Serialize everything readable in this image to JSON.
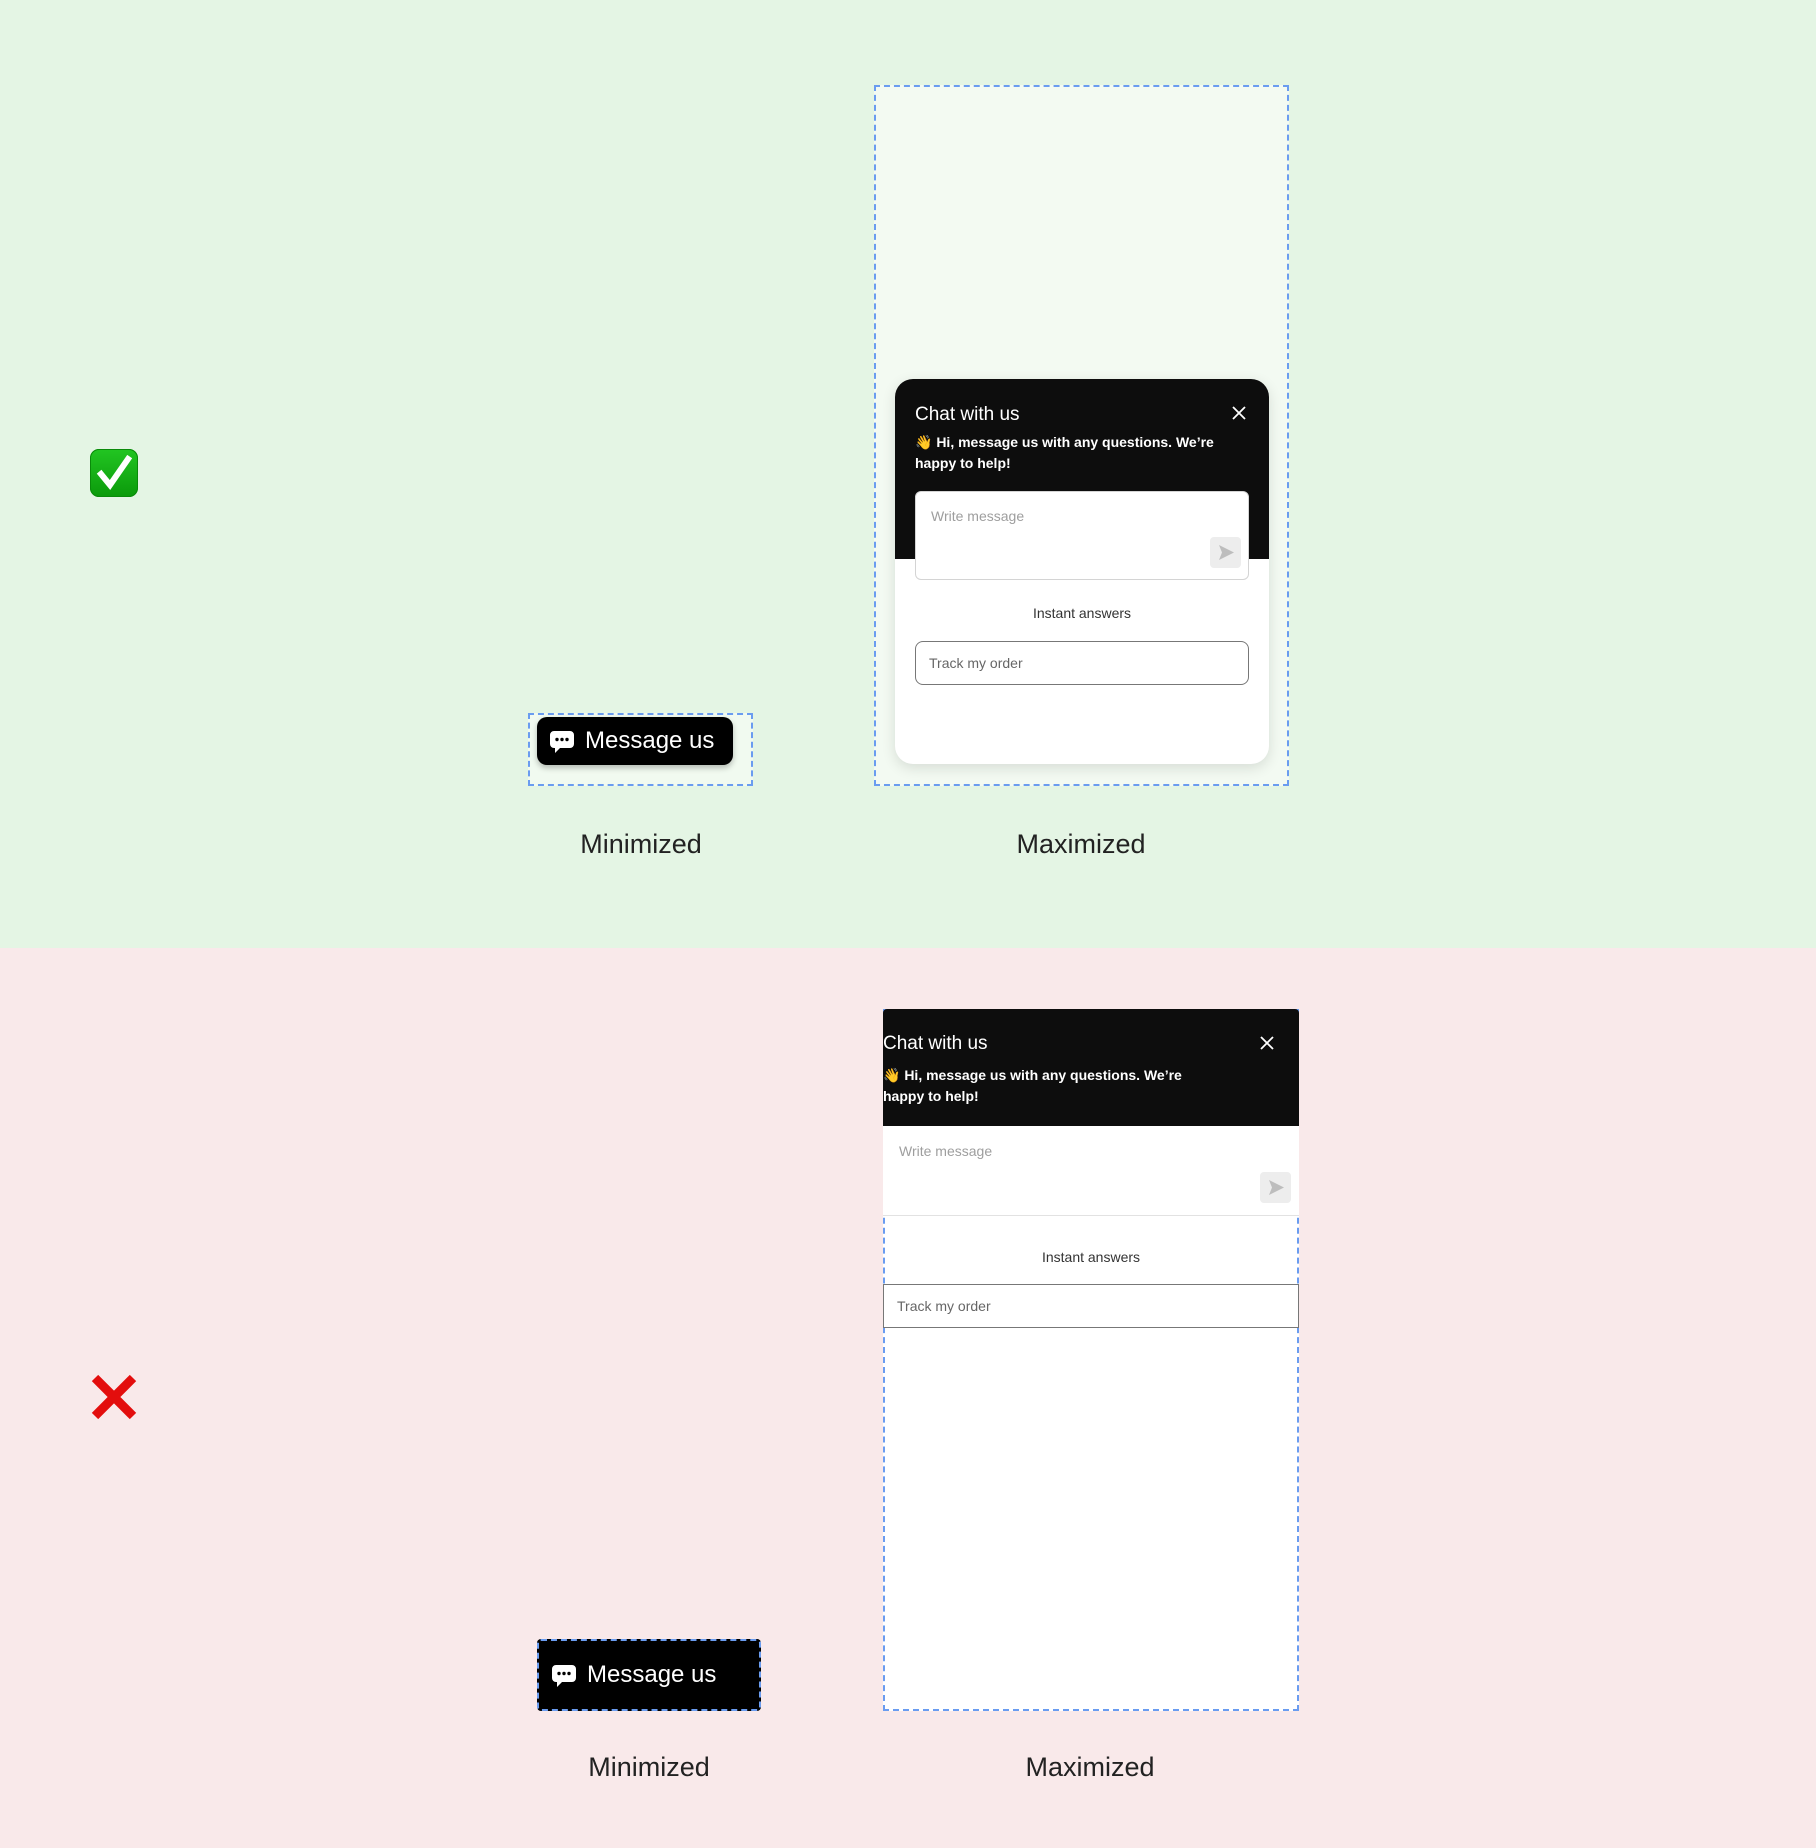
{
  "good_example": {
    "verdict_icon": "check-mark-button-icon",
    "accent_color": "#e4f5e4",
    "minimized": {
      "button_label": "Message us",
      "button_icon": "speech-bubble-icon",
      "caption": "Minimized"
    },
    "maximized": {
      "caption": "Maximized",
      "chat": {
        "title": "Chat with us",
        "close_icon": "close-icon",
        "greeting": "👋 Hi, message us with any questions. We’re happy to help!",
        "message_placeholder": "Write message",
        "send_icon": "send-icon",
        "instant_answers_heading": "Instant answers",
        "instant_answers": [
          "Track my order"
        ]
      }
    }
  },
  "bad_example": {
    "verdict_icon": "cross-mark-icon",
    "accent_color": "#f9e9ea",
    "minimized": {
      "button_label": "Message us",
      "button_icon": "speech-bubble-icon",
      "caption": "Minimized"
    },
    "maximized": {
      "caption": "Maximized",
      "chat": {
        "title": "Chat with us",
        "close_icon": "close-icon",
        "greeting": "👋 Hi, message us with any questions. We’re happy to help!",
        "message_placeholder": "Write message",
        "send_icon": "send-icon",
        "instant_answers_heading": "Instant answers",
        "instant_answers": [
          "Track my order"
        ]
      }
    }
  }
}
